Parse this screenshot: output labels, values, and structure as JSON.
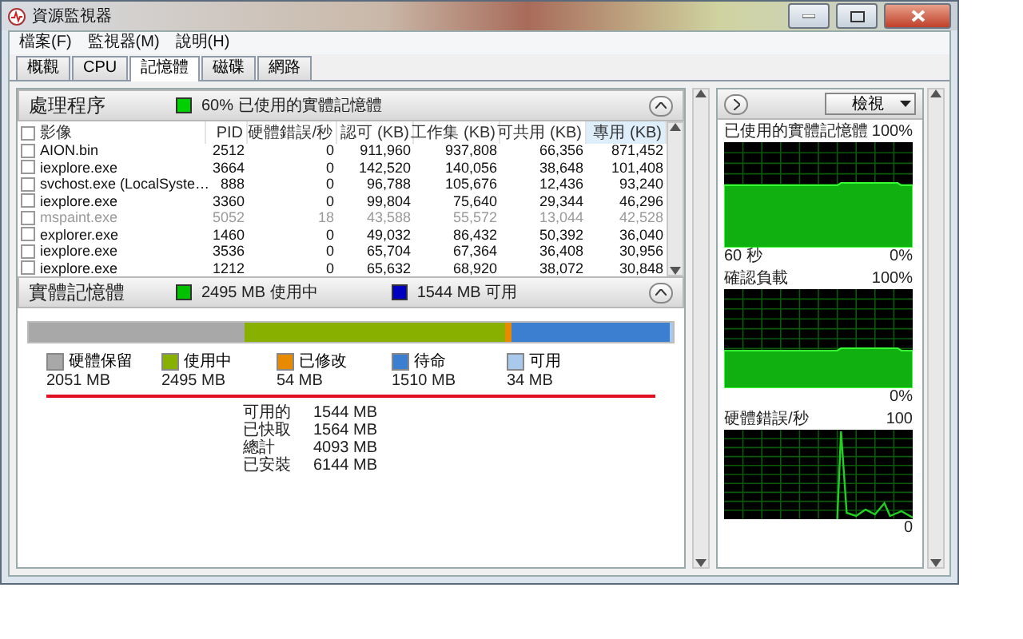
{
  "window": {
    "title": "資源監視器"
  },
  "menu": [
    {
      "label": "檔案(F)"
    },
    {
      "label": "監視器(M)"
    },
    {
      "label": "說明(H)"
    }
  ],
  "tabs": [
    {
      "label": "概觀",
      "selected": false
    },
    {
      "label": "CPU",
      "selected": false
    },
    {
      "label": "記憶體",
      "selected": true
    },
    {
      "label": "磁碟",
      "selected": false
    },
    {
      "label": "網路",
      "selected": false
    }
  ],
  "processes": {
    "title": "處理程序",
    "summary": "60% 已使用的實體記憶體",
    "columns": [
      {
        "label": "影像",
        "sorted": false
      },
      {
        "label": "PID",
        "sorted": false
      },
      {
        "label": "硬體錯誤/秒",
        "sorted": false
      },
      {
        "label": "認可 (KB)",
        "sorted": false
      },
      {
        "label": "工作集 (KB)",
        "sorted": false
      },
      {
        "label": "可共用 (KB)",
        "sorted": false
      },
      {
        "label": "專用 (KB)",
        "sorted": true
      }
    ],
    "rows": [
      {
        "checked": false,
        "ended": false,
        "cells": [
          "AION.bin",
          "2512",
          "0",
          "911,960",
          "937,808",
          "66,356",
          "871,452"
        ]
      },
      {
        "checked": false,
        "ended": false,
        "cells": [
          "iexplore.exe",
          "3664",
          "0",
          "142,520",
          "140,056",
          "38,648",
          "101,408"
        ]
      },
      {
        "checked": false,
        "ended": false,
        "cells": [
          "svchost.exe (LocalSyste…",
          "888",
          "0",
          "96,788",
          "105,676",
          "12,436",
          "93,240"
        ]
      },
      {
        "checked": false,
        "ended": false,
        "cells": [
          "iexplore.exe",
          "3360",
          "0",
          "99,804",
          "75,640",
          "29,344",
          "46,296"
        ]
      },
      {
        "checked": false,
        "ended": true,
        "cells": [
          "mspaint.exe",
          "5052",
          "18",
          "43,588",
          "55,572",
          "13,044",
          "42,528"
        ]
      },
      {
        "checked": false,
        "ended": false,
        "cells": [
          "explorer.exe",
          "1460",
          "0",
          "49,032",
          "86,432",
          "50,392",
          "36,040"
        ]
      },
      {
        "checked": false,
        "ended": false,
        "cells": [
          "iexplore.exe",
          "3536",
          "0",
          "65,704",
          "67,364",
          "36,408",
          "30,956"
        ]
      },
      {
        "checked": false,
        "ended": false,
        "cells": [
          "iexplore.exe",
          "1212",
          "0",
          "65,632",
          "68,920",
          "38,072",
          "30,848"
        ]
      }
    ]
  },
  "physical_memory": {
    "title": "實體記憶體",
    "indicators": [
      {
        "label": "2495 MB 使用中",
        "color": "#00c000"
      },
      {
        "label": "1544 MB 可用",
        "color": "#0000c0"
      }
    ],
    "legend": [
      {
        "label": "硬體保留",
        "value": "2051 MB",
        "color": "#a8a8a8"
      },
      {
        "label": "使用中",
        "value": "2495 MB",
        "color": "#88b000"
      },
      {
        "label": "已修改",
        "value": "54 MB",
        "color": "#e88a00"
      },
      {
        "label": "待命",
        "value": "1510 MB",
        "color": "#3c7fd0"
      },
      {
        "label": "可用",
        "value": "34 MB",
        "color": "#a8c8ec"
      }
    ],
    "summary": [
      {
        "label": "可用的",
        "value": "1544 MB"
      },
      {
        "label": "已快取",
        "value": "1564 MB"
      },
      {
        "label": "總計",
        "value": "4093 MB"
      },
      {
        "label": "已安裝",
        "value": "6144 MB"
      }
    ]
  },
  "graphs_pane": {
    "view_button": "檢視",
    "graphs": [
      {
        "title": "已使用的實體記憶體",
        "kind": "area",
        "scale_max": "100%",
        "scale_min": "0%",
        "time_label": "60 秒"
      },
      {
        "title": "確認負載",
        "kind": "area",
        "scale_max": "100%",
        "scale_min": "0%"
      },
      {
        "title": "硬體錯誤/秒",
        "kind": "spike",
        "scale_max": "100",
        "scale_min": "0"
      }
    ]
  }
}
